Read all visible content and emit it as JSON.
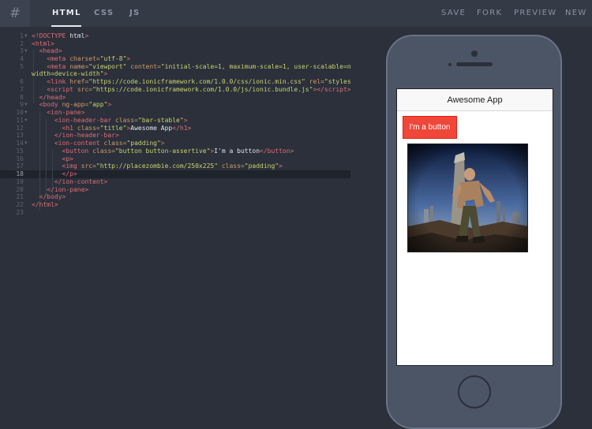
{
  "toolbar": {
    "logo": "#",
    "tabs": [
      "HTML",
      "CSS",
      "JS"
    ],
    "active_tab": "HTML",
    "actions": [
      "SAVE",
      "FORK",
      "PREVIEW",
      "NEW"
    ]
  },
  "editor": {
    "active_line": 18,
    "line_numbers": [
      "1",
      "2",
      "3",
      "4",
      "5",
      "",
      "6",
      "7",
      "8",
      "9",
      "10",
      "11",
      "12",
      "13",
      "14",
      "15",
      "16",
      "17",
      "18",
      "19",
      "20",
      "21",
      "22",
      "23"
    ]
  },
  "preview": {
    "app_title": "Awesome App",
    "button_label": "I'm a button",
    "image_alt": "zombie photo"
  },
  "colors": {
    "accent_button": "#ef473a",
    "editor_bg": "#2b303b",
    "phone_body": "#4c5566"
  }
}
